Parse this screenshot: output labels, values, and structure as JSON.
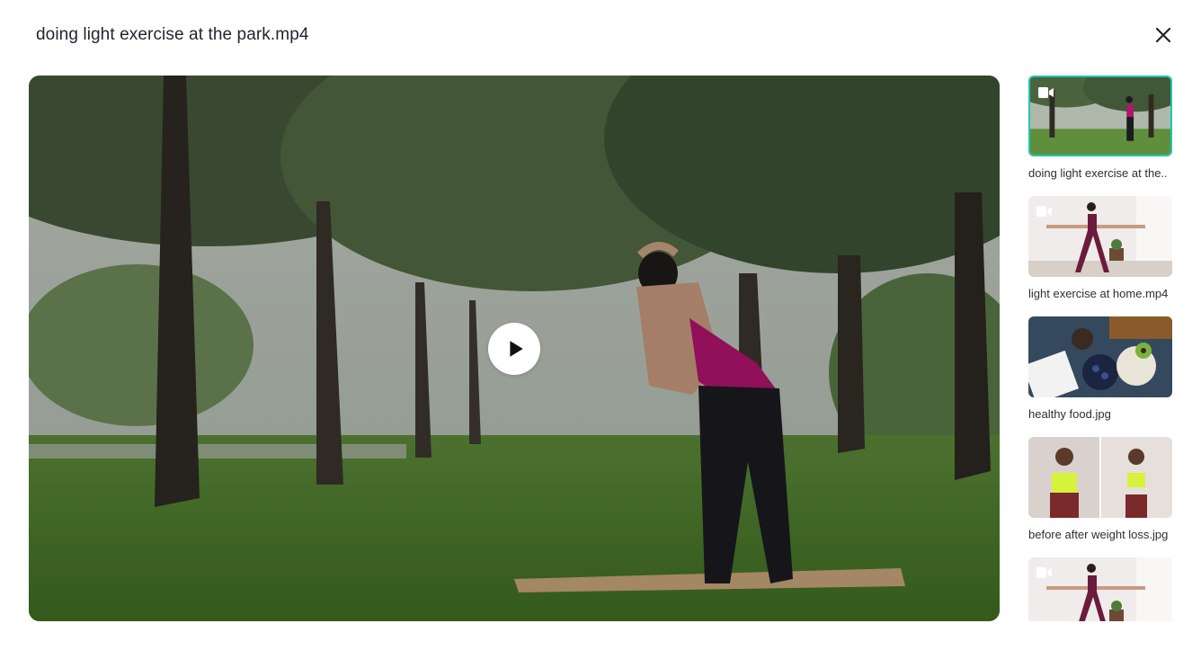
{
  "viewer": {
    "title": "doing light exercise at the park.mp4"
  },
  "icons": {
    "close": "close-icon",
    "play": "play-icon",
    "video": "video-camera-icon"
  },
  "colors": {
    "active_border": "#1fc6b0",
    "title_text": "#1f2430"
  },
  "gallery": {
    "items": [
      {
        "label": "doing light exercise at the..",
        "type": "video",
        "active": true
      },
      {
        "label": "light exercise at home.mp4",
        "type": "video",
        "active": false
      },
      {
        "label": "healthy food.jpg",
        "type": "image",
        "active": false
      },
      {
        "label": "before after weight loss.jpg",
        "type": "image",
        "active": false
      },
      {
        "label": "",
        "type": "video",
        "active": false
      }
    ]
  }
}
